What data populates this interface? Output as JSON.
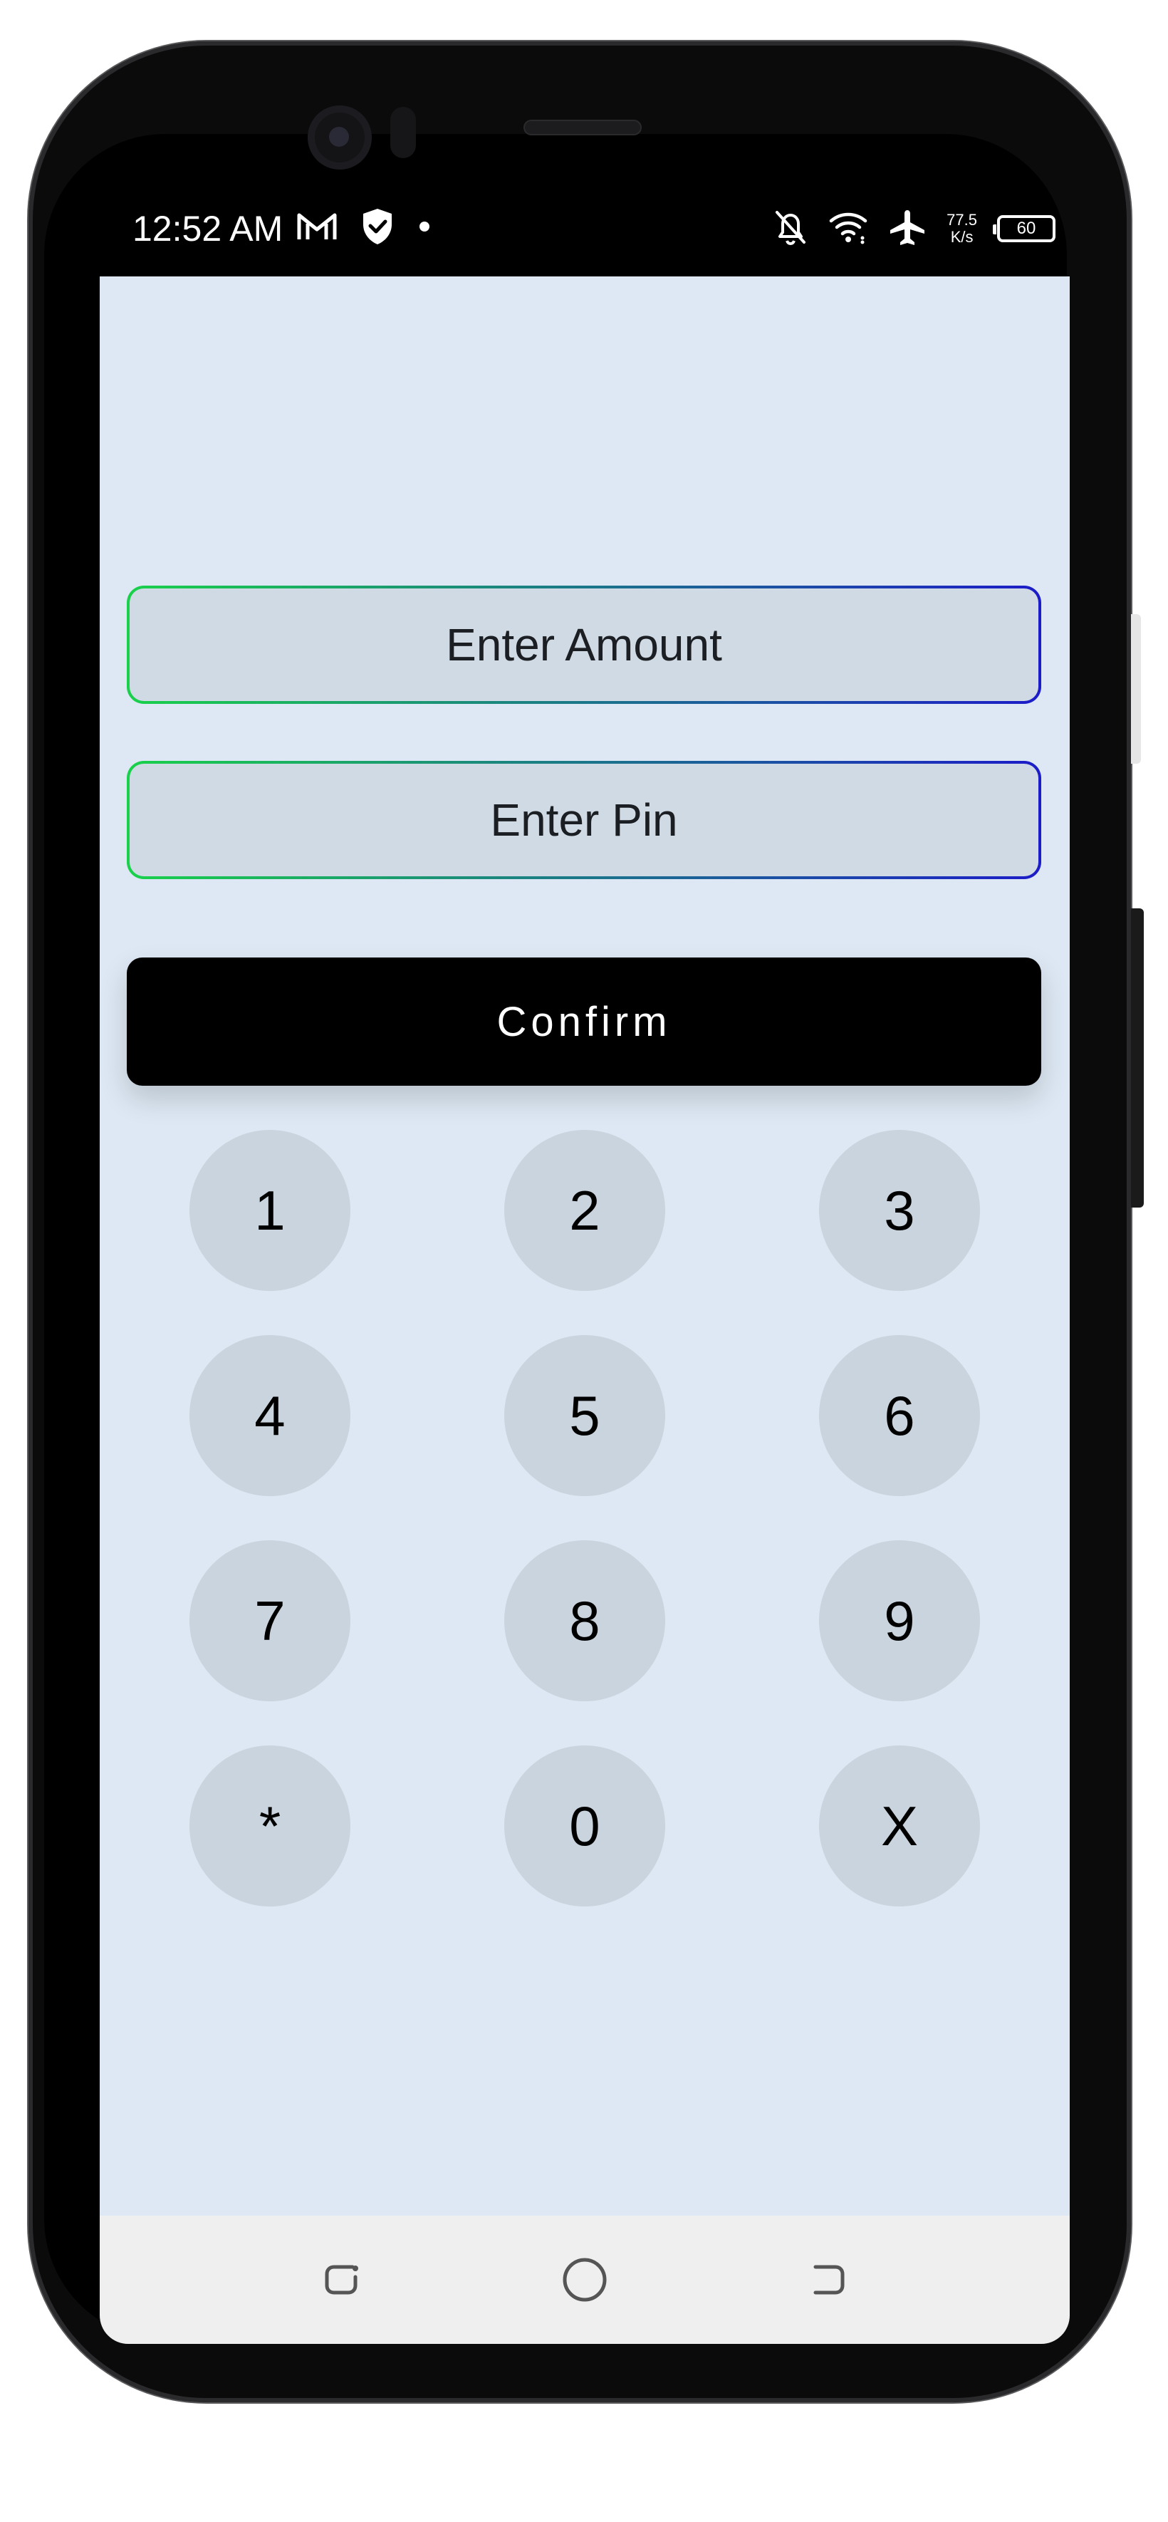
{
  "status_bar": {
    "time": "12:52 AM",
    "net_speed_value": "77.5",
    "net_speed_unit": "K/s",
    "battery_level": "60",
    "left_icons": [
      "gmail-icon",
      "shield-check-icon",
      "notification-dot-icon"
    ],
    "right_icons": [
      "bell-off-icon",
      "wifi-icon",
      "airplane-icon"
    ]
  },
  "form": {
    "amount_placeholder": "Enter Amount",
    "pin_placeholder": "Enter Pin",
    "confirm_label": "Confirm",
    "field_border_gradient": [
      "#19d14a",
      "#1c1cc8"
    ]
  },
  "keypad": {
    "keys": [
      "1",
      "2",
      "3",
      "4",
      "5",
      "6",
      "7",
      "8",
      "9",
      "*",
      "0",
      "X"
    ]
  },
  "nav_bar": {
    "icons": [
      "recent-apps-icon",
      "home-icon",
      "back-icon"
    ]
  },
  "colors": {
    "screen_background": "#dde8f4",
    "key_background": "#c9d4de",
    "button_background": "#000000"
  }
}
